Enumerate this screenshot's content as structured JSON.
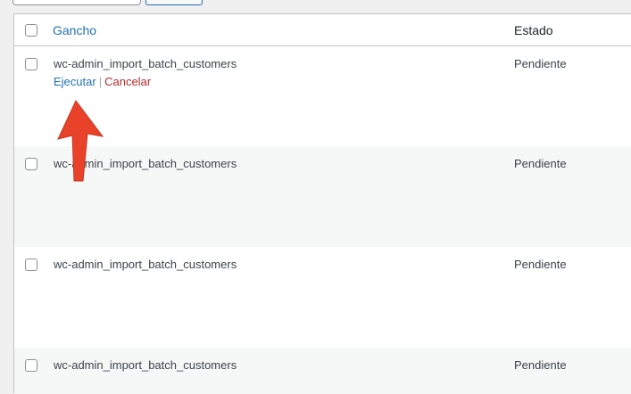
{
  "table": {
    "header": {
      "hook_label": "Gancho",
      "status_label": "Estado"
    },
    "rows": [
      {
        "hook": "wc-admin_import_batch_customers",
        "status": "Pendiente",
        "actions": {
          "run": "Ejecutar",
          "separator": "|",
          "cancel": "Cancelar"
        }
      },
      {
        "hook": "wc-admin_import_batch_customers",
        "status": "Pendiente"
      },
      {
        "hook": "wc-admin_import_batch_customers",
        "status": "Pendiente"
      },
      {
        "hook": "wc-admin_import_batch_customers",
        "status": "Pendiente"
      }
    ]
  },
  "annotation": {
    "icon": "arrow-up-icon",
    "color": "#e8432a"
  },
  "colors": {
    "link": "#2271b1",
    "danger": "#b32d2e",
    "border": "#c3c4c7"
  }
}
